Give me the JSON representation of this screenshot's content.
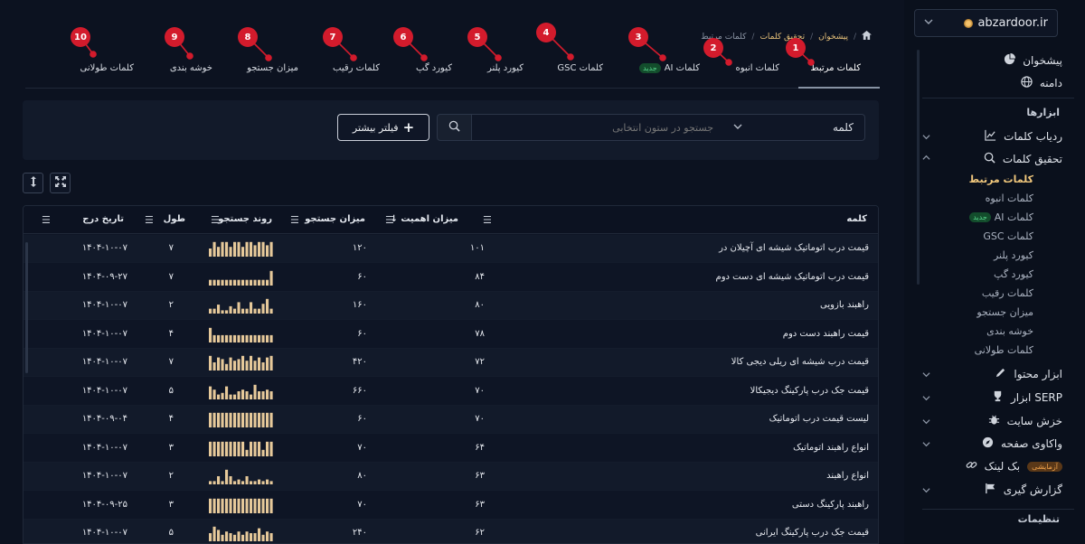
{
  "sidebar": {
    "domain": "abzardoor.ir",
    "top_items": [
      {
        "label": "پیشخوان",
        "icon": "pie-chart-icon"
      },
      {
        "label": "دامنه",
        "icon": "globe-icon"
      }
    ],
    "section_tools": "ابزارها",
    "tool_items": [
      {
        "label": "ردیاب کلمات",
        "icon": "chart-line-icon"
      },
      {
        "label": "تحقیق کلمات",
        "icon": "search-icon"
      }
    ],
    "sub_items": [
      "کلمات مرتبط",
      "کلمات انبوه",
      "کلمات AI",
      "کلمات GSC",
      "کیورد پلنر",
      "کیورد گپ",
      "کلمات رقیب",
      "میزان جستجو",
      "خوشه بندی",
      "کلمات طولانی"
    ],
    "new_badge": "جدید",
    "more_items": [
      {
        "label": "ابزار محتوا",
        "icon": "pencil-icon"
      },
      {
        "label": "ابزار SERP",
        "icon": "trophy-icon"
      },
      {
        "label": "خزش سایت",
        "icon": "bug-icon"
      },
      {
        "label": "واکاوی صفحه",
        "icon": "compass-icon"
      },
      {
        "label": "بک لینک",
        "icon": "link-icon"
      },
      {
        "label": "گزارش گیری",
        "icon": "flag-icon"
      }
    ],
    "trial_badge": "آزمایشی",
    "section_settings": "تنظیمات"
  },
  "breadcrumb": {
    "home": "home-icon",
    "items": [
      "پیشخوان",
      "تحقیق کلمات",
      "کلمات مرتبط"
    ]
  },
  "tabs": [
    "کلمات مرتبط",
    "کلمات انبوه",
    "کلمات AI",
    "کلمات GSC",
    "کیورد پلنر",
    "کیورد گپ",
    "کلمات رقیب",
    "میزان جستجو",
    "خوشه بندی",
    "کلمات طولانی"
  ],
  "tab_new_badge": "جدید",
  "markers": [
    "1",
    "2",
    "3",
    "4",
    "5",
    "6",
    "7",
    "8",
    "9",
    "10"
  ],
  "filters": {
    "column": "کلمه",
    "search_placeholder": "جستجو در ستون انتخابی",
    "more_filter": "فیلتر بیشتر"
  },
  "table": {
    "headers": {
      "keyword": "کلمه",
      "importance": "میزان اهمیت ↓",
      "volume": "میزان جستجو",
      "trend": "روند جستجو",
      "length": "طول",
      "date": "تاریخ درج"
    },
    "rows": [
      {
        "keyword": "قیمت درب اتوماتیک شیشه ای آچیلان در",
        "importance": "۱۰۱",
        "volume": "۱۲۰",
        "length": "۷",
        "date": "۱۴۰۴-۱۰-۰۷",
        "trend": [
          0.5,
          0.9,
          0.6,
          0.9,
          0.9,
          0.6,
          0.9,
          0.9,
          0.6,
          0.9,
          0.9,
          0.7,
          0.9,
          0.9,
          0.7,
          0.9
        ]
      },
      {
        "keyword": "قیمت درب اتوماتیک شیشه ای دست دوم",
        "importance": "۸۴",
        "volume": "۶۰",
        "length": "۷",
        "date": "۱۴۰۴-۰۹-۲۷",
        "trend": [
          0.35,
          0.35,
          0.35,
          0.35,
          0.35,
          0.35,
          0.35,
          0.35,
          0.35,
          0.35,
          0.35,
          0.35,
          0.35,
          0.35,
          0.35,
          0.9
        ]
      },
      {
        "keyword": "راهبند بازویی",
        "importance": "۸۰",
        "volume": "۱۶۰",
        "length": "۲",
        "date": "۱۴۰۴-۱۰-۰۷",
        "trend": [
          0.3,
          0.3,
          0.55,
          0.2,
          0.2,
          0.45,
          0.3,
          0.7,
          0.3,
          0.3,
          0.7,
          0.3,
          0.3,
          0.6,
          0.9,
          0.3
        ]
      },
      {
        "keyword": "قیمت راهبند دست دوم",
        "importance": "۷۸",
        "volume": "۶۰",
        "length": "۴",
        "date": "۱۴۰۴-۱۰-۰۷",
        "trend": [
          0.9,
          0.45,
          0.45,
          0.45,
          0.45,
          0.45,
          0.45,
          0.45,
          0.45,
          0.45,
          0.45,
          0.45,
          0.45,
          0.45,
          0.45,
          0.45
        ]
      },
      {
        "keyword": "قیمت درب شیشه ای ریلی دیجی کالا",
        "importance": "۷۲",
        "volume": "۴۲۰",
        "length": "۷",
        "date": "۱۴۰۴-۱۰-۰۷",
        "trend": [
          0.9,
          0.5,
          0.8,
          0.7,
          0.4,
          0.8,
          0.6,
          0.7,
          0.9,
          0.6,
          0.9,
          0.6,
          0.8,
          0.5,
          0.8,
          0.9
        ]
      },
      {
        "keyword": "قیمت جک درب پارکینگ دیجیکالا",
        "importance": "۷۰",
        "volume": "۶۶۰",
        "length": "۵",
        "date": "۱۴۰۴-۱۰-۰۷",
        "trend": [
          0.8,
          0.6,
          0.3,
          0.4,
          0.8,
          0.3,
          0.3,
          0.5,
          0.6,
          0.5,
          0.3,
          0.9,
          0.5,
          0.5,
          0.6,
          0.5
        ]
      },
      {
        "keyword": "لیست قیمت درب اتوماتیک",
        "importance": "۷۰",
        "volume": "۶۰",
        "length": "۴",
        "date": "۱۴۰۴-۰۹-۰۴",
        "trend": [
          0.9,
          0.9,
          0.9,
          0.9,
          0.9,
          0.9,
          0.9,
          0.9,
          0.9,
          0.9,
          0.9,
          0.9,
          0.9,
          0.9,
          0.9,
          0.9
        ]
      },
      {
        "keyword": "انواع راهبند اتوماتیک",
        "importance": "۶۴",
        "volume": "۷۰",
        "length": "۳",
        "date": "۱۴۰۴-۱۰-۰۷",
        "trend": [
          0.9,
          0.9,
          0.9,
          0.9,
          0.9,
          0.9,
          0.9,
          0.9,
          0.9,
          0.4,
          0.9,
          0.9,
          0.9,
          0.4,
          0.9,
          0.9
        ]
      },
      {
        "keyword": "انواع راهبند",
        "importance": "۶۳",
        "volume": "۸۰",
        "length": "۲",
        "date": "۱۴۰۴-۱۰-۰۷",
        "trend": [
          0.2,
          0.2,
          0.5,
          0.2,
          0.9,
          0.5,
          0.2,
          0.3,
          0.2,
          0.5,
          0.2,
          0.2,
          0.3,
          0.2,
          0.3,
          0.2
        ]
      },
      {
        "keyword": "راهبند پارکینگ دستی",
        "importance": "۶۳",
        "volume": "۷۰",
        "length": "۳",
        "date": "۱۴۰۴-۰۹-۲۵",
        "trend": [
          0.9,
          0.9,
          0.9,
          0.9,
          0.9,
          0.9,
          0.9,
          0.9,
          0.9,
          0.9,
          0.9,
          0.9,
          0.9,
          0.9,
          0.9,
          0.9
        ]
      },
      {
        "keyword": "قیمت جک درب پارکینگ ایرانی",
        "importance": "۶۲",
        "volume": "۲۴۰",
        "length": "۵",
        "date": "۱۴۰۴-۱۰-۰۷",
        "trend": [
          0.5,
          0.9,
          0.7,
          0.4,
          0.6,
          0.5,
          0.4,
          0.6,
          0.4,
          0.6,
          0.5,
          0.5,
          0.8,
          0.4,
          0.6,
          0.5
        ]
      }
    ]
  },
  "colors": {
    "accent": "#f0c77c",
    "bar": "#e6c99a",
    "marker": "#d31b2c",
    "bg": "#0c1220"
  }
}
